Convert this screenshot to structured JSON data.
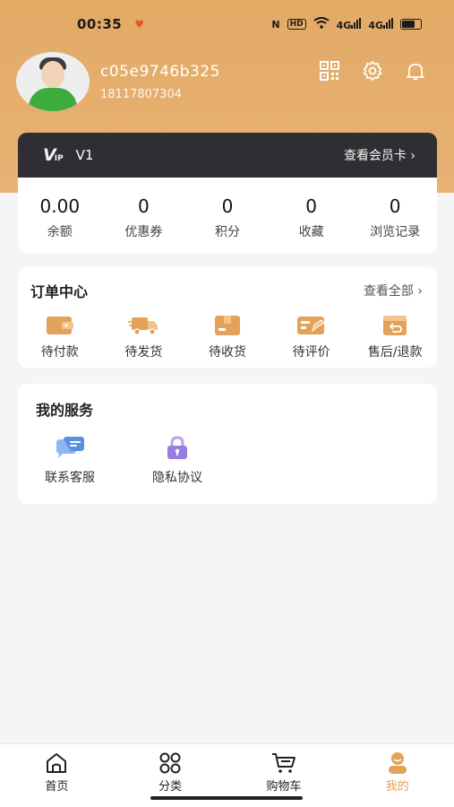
{
  "status": {
    "time": "00:35",
    "nfc": "N",
    "hd": "HD",
    "net1": "4G",
    "net2": "4G"
  },
  "profile": {
    "user_id": "c05e9746b325",
    "phone": "18117807304"
  },
  "vip": {
    "level": "V1",
    "logo": "V",
    "logo_sub": "IP",
    "card_link": "查看会员卡 ›"
  },
  "stats": [
    {
      "value": "0.00",
      "label": "余额"
    },
    {
      "value": "0",
      "label": "优惠券"
    },
    {
      "value": "0",
      "label": "积分"
    },
    {
      "value": "0",
      "label": "收藏"
    },
    {
      "value": "0",
      "label": "浏览记录"
    }
  ],
  "orders": {
    "title": "订单中心",
    "more": "查看全部 ›",
    "items": [
      {
        "label": "待付款",
        "icon": "wallet-icon"
      },
      {
        "label": "待发货",
        "icon": "truck-icon"
      },
      {
        "label": "待收货",
        "icon": "box-icon"
      },
      {
        "label": "待评价",
        "icon": "review-icon"
      },
      {
        "label": "售后/退款",
        "icon": "refund-icon"
      }
    ]
  },
  "services": {
    "title": "我的服务",
    "items": [
      {
        "label": "联系客服",
        "icon": "chat-icon"
      },
      {
        "label": "隐私协议",
        "icon": "lock-icon"
      }
    ]
  },
  "tabs": [
    {
      "label": "首页",
      "icon": "home-icon"
    },
    {
      "label": "分类",
      "icon": "grid-icon"
    },
    {
      "label": "购物车",
      "icon": "cart-icon"
    },
    {
      "label": "我的",
      "icon": "profile-icon",
      "active": true
    }
  ],
  "colors": {
    "header": "#e3aa66",
    "accent": "#e3a25a",
    "vip_bar": "#2f2f33",
    "service_chat": "#5a8fe0",
    "service_lock": "#9a7be0"
  }
}
